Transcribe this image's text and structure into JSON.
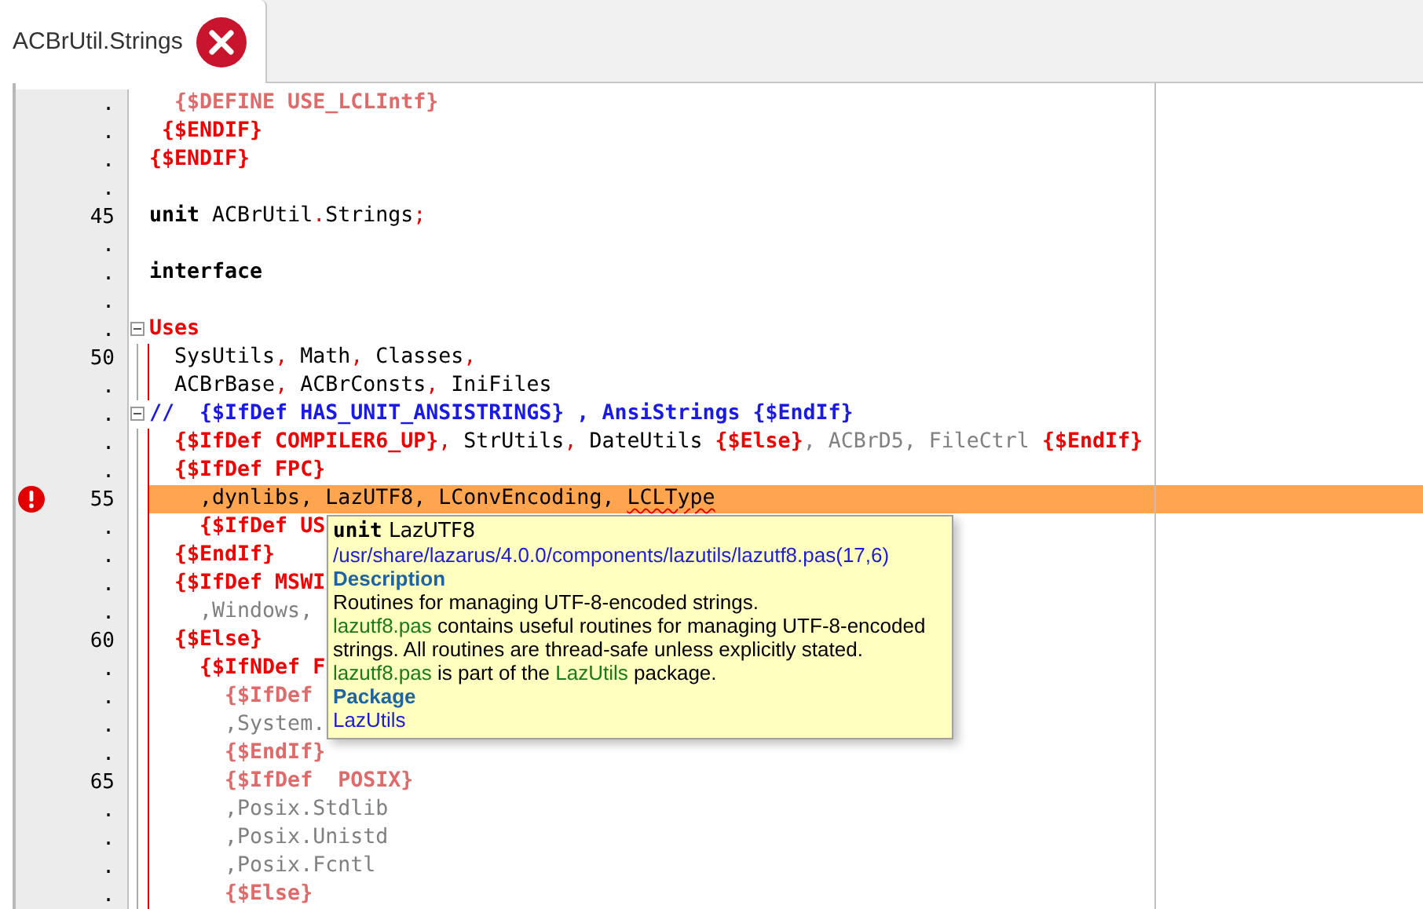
{
  "tab": {
    "label": "ACBrUtil.Strings",
    "selected": true
  },
  "editor": {
    "lines": [
      {
        "number": ".",
        "kind": "plain",
        "error": false,
        "highlighted": false,
        "tokens": [
          {
            "kind": "dir_off",
            "text": "  {$DEFINE USE_LCLIntf}"
          }
        ]
      },
      {
        "number": ".",
        "kind": "plain",
        "error": false,
        "highlighted": false,
        "tokens": [
          {
            "kind": "dir",
            "text": " {$ENDIF}"
          }
        ]
      },
      {
        "number": ".",
        "kind": "plain",
        "error": false,
        "highlighted": false,
        "tokens": [
          {
            "kind": "dir",
            "text": "{$ENDIF}"
          }
        ]
      },
      {
        "number": ".",
        "kind": "plain",
        "error": false,
        "highlighted": false
      },
      {
        "number": "45",
        "kind": "plain",
        "error": false,
        "highlighted": false,
        "tokens": [
          {
            "kind": "kw",
            "text": "unit"
          },
          {
            "kind": "id",
            "text": " ACBrUtil"
          },
          {
            "kind": "sym",
            "text": "."
          },
          {
            "kind": "id",
            "text": "Strings"
          },
          {
            "kind": "sym",
            "text": ";"
          }
        ]
      },
      {
        "number": ".",
        "kind": "plain",
        "error": false,
        "highlighted": false
      },
      {
        "number": ".",
        "kind": "plain",
        "error": false,
        "highlighted": false,
        "tokens": [
          {
            "kind": "kw",
            "text": "interface"
          }
        ]
      },
      {
        "number": ".",
        "kind": "plain",
        "error": false,
        "highlighted": false
      },
      {
        "number": ".",
        "kind": "fold_start",
        "error": false,
        "highlighted": false,
        "tokens": [
          {
            "kind": "dir",
            "text": "Uses"
          }
        ]
      },
      {
        "number": "50",
        "kind": "fold_body",
        "error": false,
        "highlighted": false,
        "tokens": [
          {
            "kind": "id",
            "text": "  SysUtils"
          },
          {
            "kind": "sym",
            "text": ","
          },
          {
            "kind": "id",
            "text": " Math"
          },
          {
            "kind": "sym",
            "text": ","
          },
          {
            "kind": "id",
            "text": " Classes"
          },
          {
            "kind": "sym",
            "text": ","
          }
        ]
      },
      {
        "number": ".",
        "kind": "fold_body",
        "error": false,
        "highlighted": false,
        "tokens": [
          {
            "kind": "id",
            "text": "  ACBrBase"
          },
          {
            "kind": "sym",
            "text": ","
          },
          {
            "kind": "id",
            "text": " ACBrConsts"
          },
          {
            "kind": "sym",
            "text": ","
          },
          {
            "kind": "id",
            "text": " IniFiles"
          }
        ]
      },
      {
        "number": ".",
        "kind": "fold_start",
        "error": false,
        "highlighted": false,
        "tokens": [
          {
            "kind": "cmt",
            "text": "//  {$IfDef HAS_UNIT_ANSISTRINGS} , AnsiStrings {$EndIf}"
          }
        ]
      },
      {
        "number": ".",
        "kind": "fold_body",
        "error": false,
        "highlighted": false,
        "tokens": [
          {
            "kind": "dir",
            "text": "  {$IfDef COMPILER6_UP}"
          },
          {
            "kind": "sym",
            "text": ","
          },
          {
            "kind": "id",
            "text": " StrUtils"
          },
          {
            "kind": "sym",
            "text": ","
          },
          {
            "kind": "id",
            "text": " DateUtils "
          },
          {
            "kind": "dir",
            "text": "{$Else}"
          },
          {
            "kind": "off",
            "text": ", ACBrD5, FileCtrl "
          },
          {
            "kind": "dir",
            "text": "{$EndIf}"
          }
        ]
      },
      {
        "number": ".",
        "kind": "fold_body",
        "error": false,
        "highlighted": false,
        "tokens": [
          {
            "kind": "dir",
            "text": "  {$IfDef FPC}"
          }
        ]
      },
      {
        "number": "55",
        "kind": "fold_body",
        "error": true,
        "highlighted": true,
        "tokens": [
          {
            "kind": "id",
            "text": "    ,dynlibs, LazUTF8, LConvEncoding, "
          },
          {
            "kind": "id",
            "text": "LCLType",
            "squiggly": true
          }
        ]
      },
      {
        "number": ".",
        "kind": "fold_body",
        "error": false,
        "highlighted": false,
        "tokens": [
          {
            "kind": "dir",
            "text": "    {$IfDef US"
          }
        ]
      },
      {
        "number": ".",
        "kind": "fold_body",
        "error": false,
        "highlighted": false,
        "tokens": [
          {
            "kind": "dir",
            "text": "  {$EndIf}"
          }
        ]
      },
      {
        "number": ".",
        "kind": "fold_body",
        "error": false,
        "highlighted": false,
        "tokens": [
          {
            "kind": "dir",
            "text": "  {$IfDef MSWI"
          }
        ]
      },
      {
        "number": ".",
        "kind": "fold_body",
        "error": false,
        "highlighted": false,
        "tokens": [
          {
            "kind": "off",
            "text": "    ,Windows,"
          }
        ]
      },
      {
        "number": "60",
        "kind": "fold_body",
        "error": false,
        "highlighted": false,
        "tokens": [
          {
            "kind": "dir",
            "text": "  {$Else}"
          }
        ]
      },
      {
        "number": ".",
        "kind": "fold_body",
        "error": false,
        "highlighted": false,
        "tokens": [
          {
            "kind": "dir",
            "text": "    {$IfNDef F"
          }
        ]
      },
      {
        "number": ".",
        "kind": "fold_body",
        "error": false,
        "highlighted": false,
        "tokens": [
          {
            "kind": "dir_off",
            "text": "      {$IfDef"
          }
        ]
      },
      {
        "number": ".",
        "kind": "fold_body",
        "error": false,
        "highlighted": false,
        "tokens": [
          {
            "kind": "off",
            "text": "      ,System."
          }
        ]
      },
      {
        "number": ".",
        "kind": "fold_body",
        "error": false,
        "highlighted": false,
        "tokens": [
          {
            "kind": "dir_off",
            "text": "      {$EndIf}"
          }
        ]
      },
      {
        "number": "65",
        "kind": "fold_body",
        "error": false,
        "highlighted": false,
        "tokens": [
          {
            "kind": "dir_off",
            "text": "      {$IfDef  POSIX}"
          }
        ]
      },
      {
        "number": ".",
        "kind": "fold_body",
        "error": false,
        "highlighted": false,
        "tokens": [
          {
            "kind": "off",
            "text": "      ,Posix.Stdlib"
          }
        ]
      },
      {
        "number": ".",
        "kind": "fold_body",
        "error": false,
        "highlighted": false,
        "tokens": [
          {
            "kind": "off",
            "text": "      ,Posix.Unistd"
          }
        ]
      },
      {
        "number": ".",
        "kind": "fold_body",
        "error": false,
        "highlighted": false,
        "tokens": [
          {
            "kind": "off",
            "text": "      ,Posix.Fcntl"
          }
        ]
      },
      {
        "number": ".",
        "kind": "fold_body",
        "error": false,
        "highlighted": false,
        "tokens": [
          {
            "kind": "dir_off",
            "text": "      {$Else}"
          }
        ]
      }
    ]
  },
  "tooltip": {
    "keyword": "unit",
    "name": "LazUTF8",
    "paragraphs": [
      {
        "kind": "path",
        "segments": [
          {
            "kind": "plain",
            "text": "/usr/share/lazarus/4.0.0/components/lazutils/lazutf8.pas(17,6)"
          }
        ]
      },
      {
        "kind": "heading",
        "segments": [
          {
            "kind": "plain",
            "text": "Description"
          }
        ]
      },
      {
        "kind": "text",
        "segments": [
          {
            "kind": "plain",
            "text": "Routines for managing UTF-8-encoded strings."
          }
        ]
      },
      {
        "kind": "text",
        "segments": [
          {
            "kind": "ref",
            "text": "lazutf8.pas"
          },
          {
            "kind": "plain",
            "text": " contains useful routines for managing UTF-8-encoded strings. All routines are thread-safe unless explicitly stated."
          }
        ]
      },
      {
        "kind": "text",
        "segments": [
          {
            "kind": "ref",
            "text": "lazutf8.pas"
          },
          {
            "kind": "plain",
            "text": " is part of the "
          },
          {
            "kind": "ref",
            "text": "LazUtils"
          },
          {
            "kind": "plain",
            "text": " package."
          }
        ]
      },
      {
        "kind": "heading",
        "segments": [
          {
            "kind": "plain",
            "text": "Package"
          }
        ]
      },
      {
        "kind": "path",
        "segments": [
          {
            "kind": "plain",
            "text": "LazUtils"
          }
        ]
      }
    ]
  }
}
